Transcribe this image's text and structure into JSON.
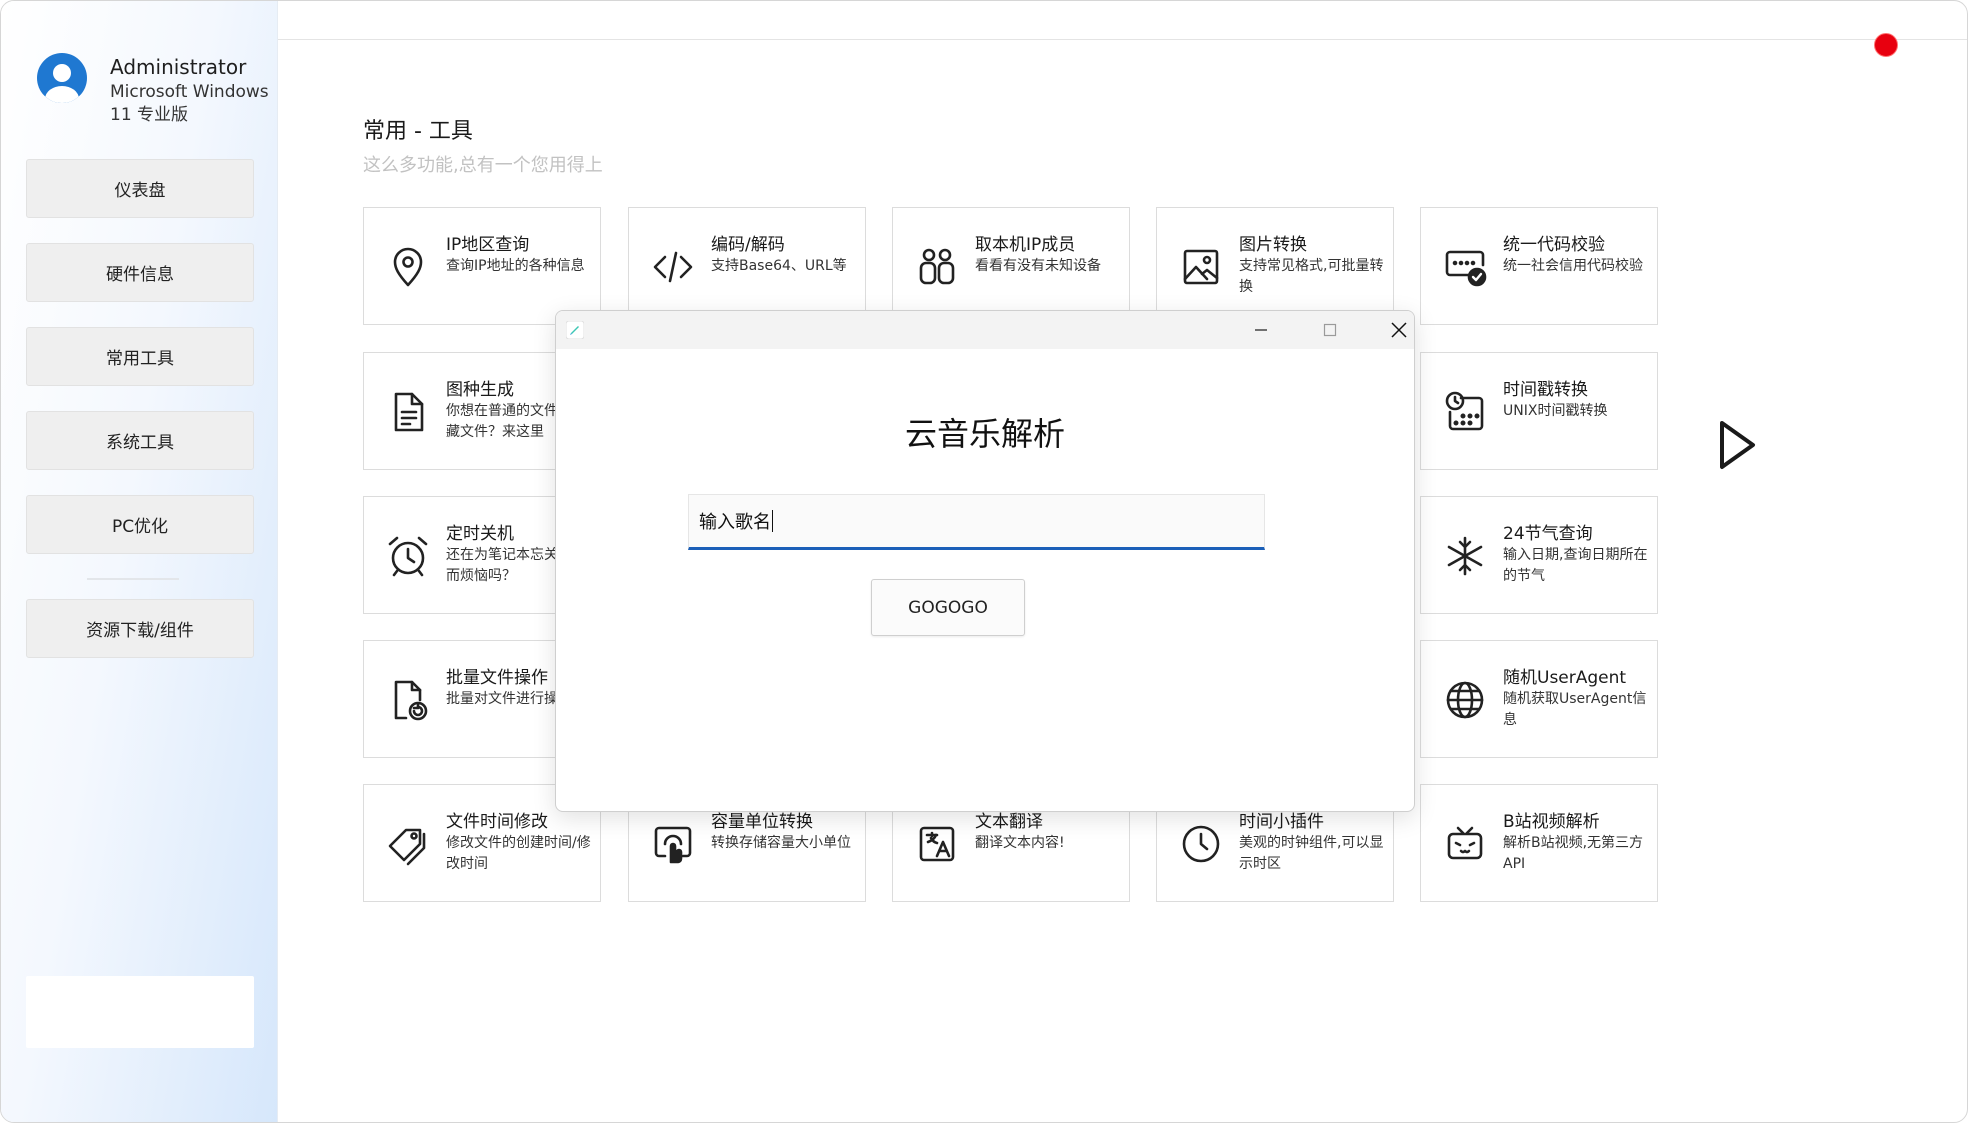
{
  "user": {
    "name": "Administrator",
    "os": "Microsoft Windows 11 专业版"
  },
  "sidebar": {
    "items": [
      {
        "label": "仪表盘"
      },
      {
        "label": "硬件信息"
      },
      {
        "label": "常用工具"
      },
      {
        "label": "系统工具"
      },
      {
        "label": "PC优化"
      },
      {
        "label": "资源下载/组件"
      }
    ]
  },
  "page": {
    "title": "常用 - 工具",
    "subtitle": "这么多功能,总有一个您用得上"
  },
  "tools": [
    {
      "title": "IP地区查询",
      "desc": "查询IP地址的各种信息",
      "icon": "location-pin-icon"
    },
    {
      "title": "编码/解码",
      "desc": "支持Base64、URL等",
      "icon": "code-icon"
    },
    {
      "title": "取本机IP成员",
      "desc": "看看有没有未知设备",
      "icon": "people-icon"
    },
    {
      "title": "图片转换",
      "desc": "支持常见格式,可批量转换",
      "icon": "image-icon"
    },
    {
      "title": "统一代码校验",
      "desc": "统一社会信用代码校验",
      "icon": "verify-icon"
    },
    {
      "title": "图种生成",
      "desc": "你想在普通的文件中隐藏文件？来这里",
      "icon": "document-icon"
    },
    {
      "title": "时间戳转换",
      "desc": "UNIX时间戳转换",
      "icon": "calendar-clock-icon"
    },
    {
      "title": "定时关机",
      "desc": "还在为笔记本忘关烧屏而烦恼吗？",
      "icon": "alarm-clock-icon"
    },
    {
      "title": "24节气查询",
      "desc": "输入日期,查询日期所在的节气",
      "icon": "snowflake-icon"
    },
    {
      "title": "批量文件操作",
      "desc": "批量对文件进行操作",
      "icon": "file-sync-icon"
    },
    {
      "title": "随机UserAgent",
      "desc": "随机获取UserAgent信息",
      "icon": "globe-icon"
    },
    {
      "title": "文件时间修改",
      "desc": "修改文件的创建时间/修改时间",
      "icon": "tags-icon"
    },
    {
      "title": "容量单位转换",
      "desc": "转换存储容量大小单位",
      "icon": "touch-icon"
    },
    {
      "title": "文本翻译",
      "desc": "翻译文本内容!",
      "icon": "translate-icon"
    },
    {
      "title": "时间小插件",
      "desc": "美观的时钟组件,可以显示时区",
      "icon": "clock-icon"
    },
    {
      "title": "B站视频解析",
      "desc": "解析B站视频,无第三方API",
      "icon": "tv-icon"
    }
  ],
  "dialog": {
    "title": "云音乐解析",
    "input_value": "输入歌名",
    "button_label": "GOGOGO"
  },
  "colors": {
    "accent": "#1b5fb8",
    "recording_dot": "#e8000f",
    "sidebar_gradient_end": "#d6e7fb"
  }
}
